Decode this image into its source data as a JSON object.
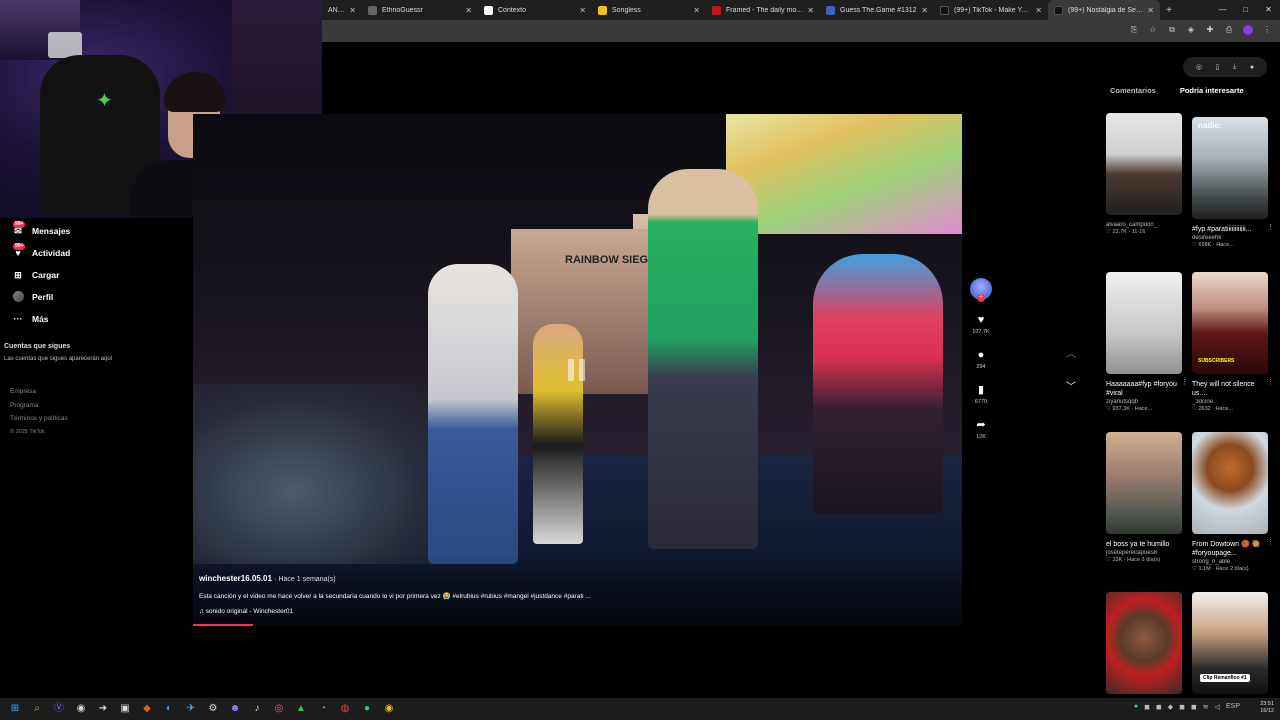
{
  "browser": {
    "tabs": [
      {
        "label": "AN y acu",
        "color": "#444"
      },
      {
        "label": "EthnoGuessr",
        "color": "#666"
      },
      {
        "label": "Contexto",
        "color": "#ffffff"
      },
      {
        "label": "Songless",
        "color": "#f0c020"
      },
      {
        "label": "Framed - The daily movie gue",
        "color": "#c01818"
      },
      {
        "label": "Guess The.Game #1312",
        "color": "#4060c0"
      },
      {
        "label": "(99+) TikTok - Make Your Day",
        "color": "#111"
      },
      {
        "label": "(99+) Nostalgia de Secund",
        "color": "#111"
      }
    ],
    "window_controls": {
      "minimize": "—",
      "maximize": "□",
      "close": "✕"
    },
    "new_tab": "+"
  },
  "sidebar": {
    "items": [
      {
        "label": "Mensajes",
        "badge": "99+",
        "icon": "message-icon"
      },
      {
        "label": "Actividad",
        "badge": "99+",
        "icon": "activity-icon"
      },
      {
        "label": "Cargar",
        "icon": "upload-icon"
      },
      {
        "label": "Perfil",
        "icon": "profile-avatar"
      },
      {
        "label": "Más",
        "icon": "more-icon"
      }
    ],
    "following_heading": "Cuentas que sigues",
    "following_desc": "Las cuentas que sigues aparecerán aquí",
    "footer": [
      "Empresa",
      "Programa",
      "Términos y políticas",
      "© 2025 TikTok"
    ]
  },
  "video": {
    "author": "winchester16.05.01",
    "time": "· Hace 1 semana(s)",
    "caption": "Esta canción y el video me hace volver a la secundaria cuando lo vi por primera vez 😭 #elrubius #rubius #mangel #justdance #parati ...",
    "sound": "♫ sonido original - Winchester01",
    "banner_text": "RAINBOW SIEGE"
  },
  "actions": {
    "likes": "107.7K",
    "comments": "294",
    "saves": "6770",
    "shares": "12K"
  },
  "right_panel": {
    "tabs": [
      "Comentarios",
      "Podría interesarte"
    ],
    "items": [
      {
        "title": "",
        "user": "alvaaro_campoon_",
        "meta": "♡ 23.7K · 11-16",
        "overlay": ""
      },
      {
        "title": "#fyp #paratiiiiiiiiiiii...",
        "user": "desireeehk",
        "meta": "♡ 698K · Hace...",
        "overlay": "nadie:"
      },
      {
        "title": "Haaaaaaa#fyp #foryou #viral",
        "user": "ziyanutsqqb",
        "meta": "♡ 937.3K · Hace...",
        "overlay": ""
      },
      {
        "title": "They will not silence us....",
        "user": "_3dcine",
        "meta": "♡ 2632 · Hace...",
        "overlay": "SUBSCRIBERS"
      },
      {
        "title": "el boss ya te humillo",
        "user": "josetepereirapues8",
        "meta": "♡ 33K · Hace 3 día(s)",
        "overlay": ""
      },
      {
        "title": "From Dowtown 🏀 🥘 #foryoupage...",
        "user": "strong_n_able",
        "meta": "♡ 1.1M · Hace 2 día(s)",
        "overlay": ""
      },
      {
        "title": "",
        "user": "",
        "meta": "",
        "overlay": ""
      },
      {
        "title": "",
        "user": "",
        "meta": "",
        "overlay": "Clip Remanfloo #1"
      }
    ]
  },
  "taskbar": {
    "time": "23:51",
    "date": "16/12"
  },
  "colors": {
    "accent": "#fe2c55",
    "background": "#000000"
  }
}
